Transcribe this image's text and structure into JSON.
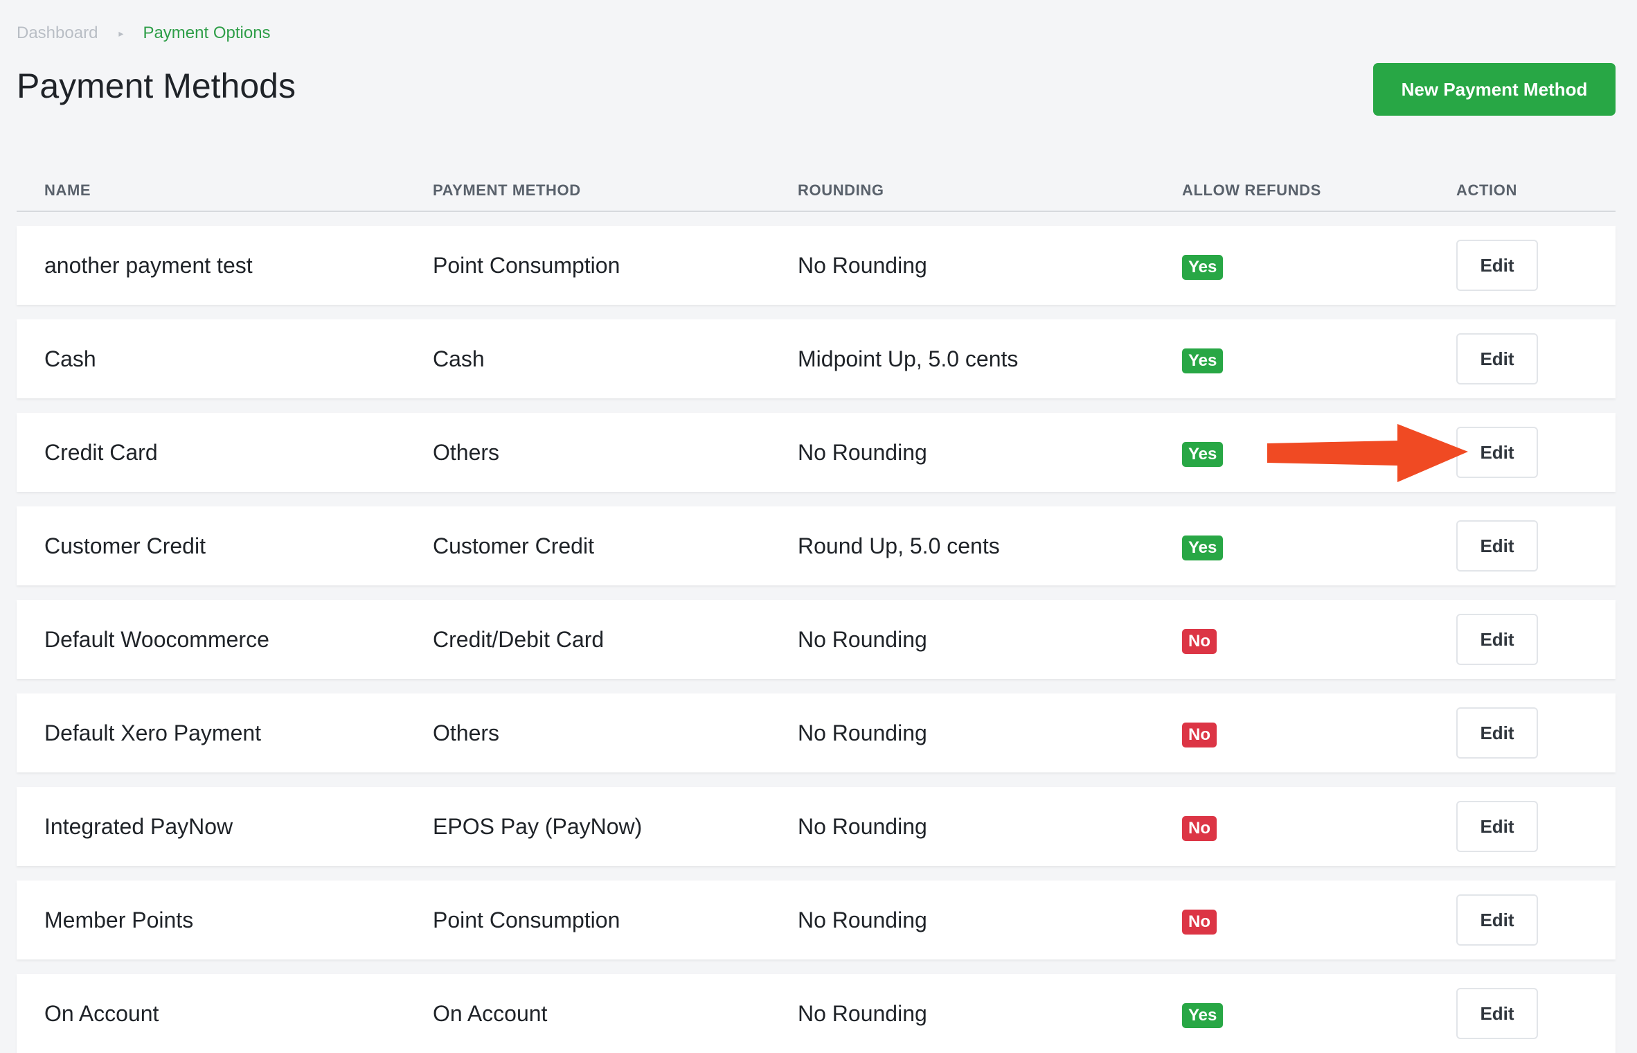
{
  "breadcrumb": {
    "home": "Dashboard",
    "separator": "▸",
    "current": "Payment Options"
  },
  "page": {
    "title": "Payment Methods",
    "new_button_label": "New Payment Method"
  },
  "table": {
    "columns": [
      "NAME",
      "PAYMENT METHOD",
      "ROUNDING",
      "ALLOW REFUNDS",
      "ACTION"
    ],
    "rows": [
      {
        "name": "another payment test",
        "method": "Point Consumption",
        "rounding": "No Rounding",
        "refunds": "Yes",
        "action": "Edit"
      },
      {
        "name": "Cash",
        "method": "Cash",
        "rounding": "Midpoint Up, 5.0 cents",
        "refunds": "Yes",
        "action": "Edit"
      },
      {
        "name": "Credit Card",
        "method": "Others",
        "rounding": "No Rounding",
        "refunds": "Yes",
        "action": "Edit"
      },
      {
        "name": "Customer Credit",
        "method": "Customer Credit",
        "rounding": "Round Up, 5.0 cents",
        "refunds": "Yes",
        "action": "Edit"
      },
      {
        "name": "Default Woocommerce",
        "method": "Credit/Debit Card",
        "rounding": "No Rounding",
        "refunds": "No",
        "action": "Edit"
      },
      {
        "name": "Default Xero Payment",
        "method": "Others",
        "rounding": "No Rounding",
        "refunds": "No",
        "action": "Edit"
      },
      {
        "name": "Integrated PayNow",
        "method": "EPOS Pay (PayNow)",
        "rounding": "No Rounding",
        "refunds": "No",
        "action": "Edit"
      },
      {
        "name": "Member Points",
        "method": "Point Consumption",
        "rounding": "No Rounding",
        "refunds": "No",
        "action": "Edit"
      },
      {
        "name": "On Account",
        "method": "On Account",
        "rounding": "No Rounding",
        "refunds": "Yes",
        "action": "Edit"
      }
    ]
  },
  "annotation": {
    "icon": "arrow-right-icon",
    "color": "#f04a23"
  },
  "colors": {
    "accent": "#28a745",
    "danger": "#dc3545",
    "background": "#f4f5f7"
  }
}
